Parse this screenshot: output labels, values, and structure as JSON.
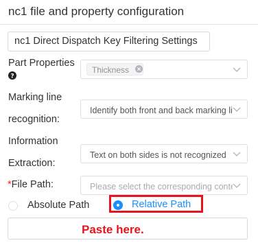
{
  "header": {
    "title": "nc1 file and property configuration"
  },
  "config_name": {
    "value": "nc1 Direct Dispatch Key Filtering Settings"
  },
  "part_properties": {
    "label": "Part Properties",
    "tags": [
      "Thickness"
    ]
  },
  "marking_line": {
    "label_line1": "Marking line",
    "label_line2": "recognition:",
    "value": "Identify both front and back marking lines"
  },
  "information_extraction": {
    "label_line1": "Information",
    "label_line2": "Extraction:",
    "value": "Text on both sides is not recognized"
  },
  "file_path": {
    "required_mark": "*",
    "label": "File Path:",
    "placeholder": "Please select the corresponding content"
  },
  "path_type": {
    "options": [
      {
        "label": "Absolute Path",
        "selected": false
      },
      {
        "label": "Relative Path",
        "selected": true
      }
    ]
  },
  "annotation": {
    "text": "Paste here.",
    "color": "#e8141d"
  },
  "colors": {
    "accent": "#1890ff",
    "highlight": "#e8141d"
  },
  "icons": [
    "question-circle-icon",
    "tag-close-icon",
    "chevron-down-icon"
  ]
}
